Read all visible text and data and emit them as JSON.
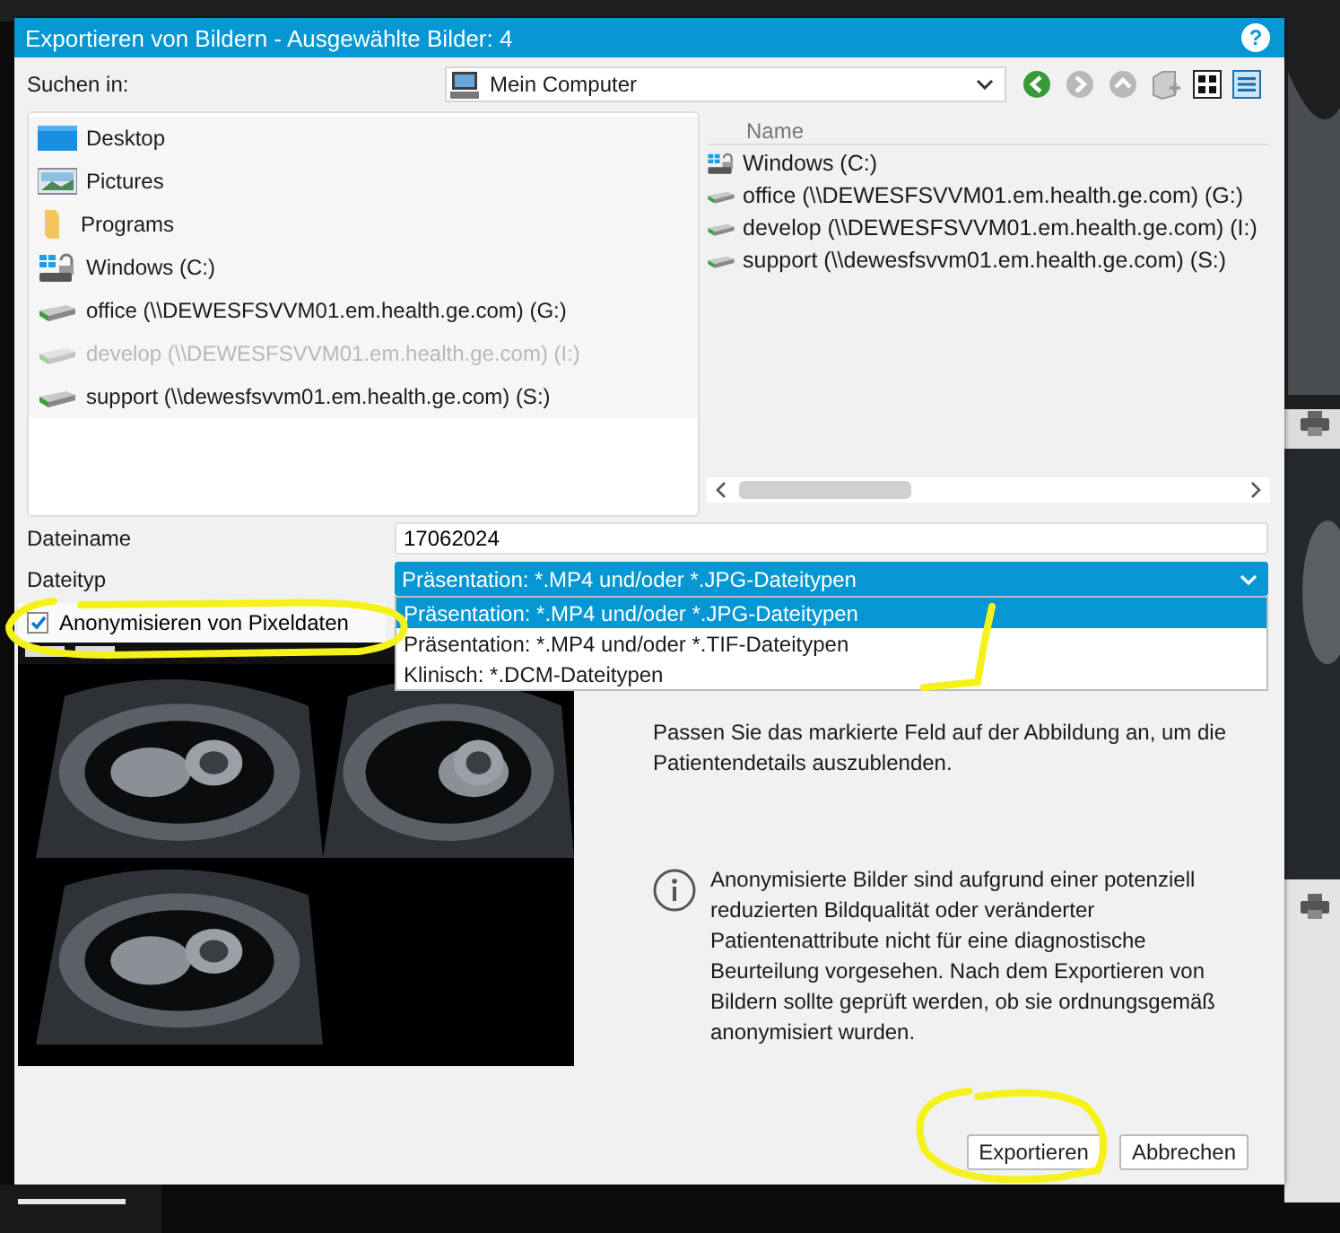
{
  "window": {
    "title": "Exportieren von Bildern - Ausgewählte Bilder: 4",
    "help": "?"
  },
  "look_in": {
    "label": "Suchen in:",
    "value": "Mein Computer"
  },
  "nav_buttons": [
    {
      "kind": "back",
      "disabled": false
    },
    {
      "kind": "forward",
      "disabled": true
    },
    {
      "kind": "up",
      "disabled": true
    },
    {
      "kind": "new-folder",
      "disabled": true
    }
  ],
  "view_buttons": [
    {
      "kind": "icons",
      "selected": false
    },
    {
      "kind": "details",
      "selected": true
    }
  ],
  "places": [
    {
      "kind": "desktop",
      "label": "Desktop",
      "disabled": false
    },
    {
      "kind": "pictures",
      "label": "Pictures",
      "disabled": false
    },
    {
      "kind": "folder",
      "label": "Programs",
      "disabled": false
    },
    {
      "kind": "windows-drive",
      "label": "Windows (C:)",
      "disabled": false
    },
    {
      "kind": "network-drive",
      "label": "office (\\\\DEWESFSVVM01.em.health.ge.com) (G:)",
      "disabled": false
    },
    {
      "kind": "network-drive",
      "label": "develop (\\\\DEWESFSVVM01.em.health.ge.com) (I:)",
      "disabled": true
    },
    {
      "kind": "network-drive",
      "label": "support (\\\\dewesfsvvm01.em.health.ge.com) (S:)",
      "disabled": false
    }
  ],
  "files": {
    "columns": [
      "Name"
    ],
    "items": [
      {
        "kind": "windows-drive",
        "label": "Windows (C:)"
      },
      {
        "kind": "network-drive",
        "label": "office (\\\\DEWESFSVVM01.em.health.ge.com) (G:)"
      },
      {
        "kind": "network-drive",
        "label": "develop (\\\\DEWESFSVVM01.em.health.ge.com) (I:)"
      },
      {
        "kind": "network-drive",
        "label": "support (\\\\dewesfsvvm01.em.health.ge.com) (S:)"
      }
    ]
  },
  "file_name": {
    "label": "Dateiname",
    "value": "17062024"
  },
  "file_type": {
    "label": "Dateityp",
    "value": "Präsentation: *.MP4 und/oder *.JPG-Dateitypen",
    "expanded": true,
    "options": [
      {
        "label": "Präsentation: *.MP4 und/oder *.JPG-Dateitypen",
        "selected": true
      },
      {
        "label": "Präsentation: *.MP4 und/oder *.TIF-Dateitypen",
        "selected": false
      },
      {
        "label": "Klinisch: *.DCM-Dateitypen",
        "selected": false
      }
    ]
  },
  "anonymize": {
    "label": "Anonymisieren von Pixeldaten",
    "checked": true
  },
  "hint": "Passen Sie das markierte Feld auf der Abbildung an, um die Patientendetails auszublenden.",
  "notice": "Anonymisierte Bilder sind aufgrund einer potenziell reduzierten Bildqualität oder veränderter Patientenattribute nicht für eine diagnostische Beurteilung vorgesehen. Nach dem Exportieren von Bildern sollte geprüft werden, ob sie ordnungsgemäß anonymisiert wurden.",
  "buttons": [
    {
      "label": "Exportieren"
    },
    {
      "label": "Abbrechen"
    }
  ]
}
